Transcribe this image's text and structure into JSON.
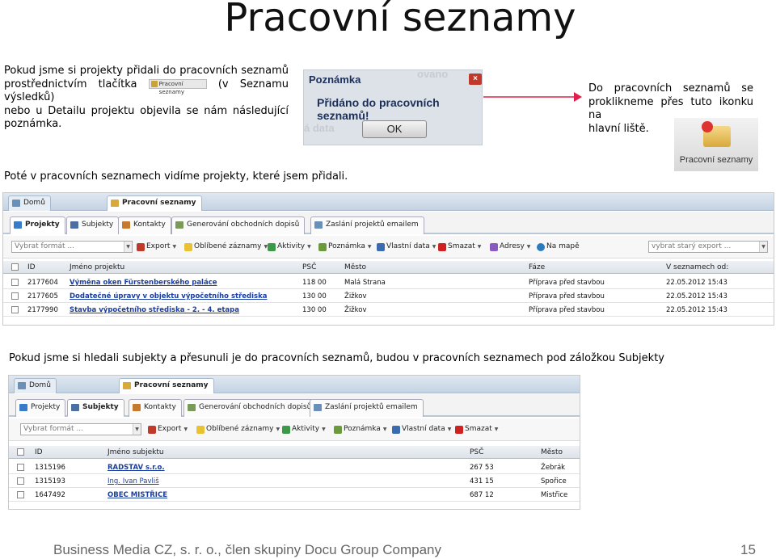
{
  "title": "Pracovní seznamy",
  "para1": {
    "line1": "Pokud jsme si projekty přidali do pracovních seznamů",
    "line2a": "prostřednictvím tlačítka",
    "button_img": "Pracovní seznamy",
    "line2b": "(v Seznamu výsledků)",
    "line3": "nebo u Detailu projektu objevila se nám následující",
    "line4": "poznámka."
  },
  "dialog": {
    "header": "Poznámka",
    "message": "Přidáno do pracovních seznamů!",
    "ok": "OK",
    "ghost1": "ovano",
    "ghost2": "á data",
    "close": "×"
  },
  "para2": {
    "line1": "Do pracovních seznamů se",
    "line2": "proklikneme přes tuto ikonku na",
    "line3": "hlavní liště."
  },
  "icon_label": "Pracovní seznamy",
  "para3": "Poté v pracovních seznamech vidíme projekty, které jsem přidali.",
  "para4": "Pokud jsme si hledali subjekty a přesunuli je do pracovních seznamů, budou v pracovních seznamech pod záložkou Subjekty",
  "shot1": {
    "top_tabs": [
      "Domů",
      "Pracovní seznamy"
    ],
    "sub_tabs": [
      "Projekty",
      "Subjekty",
      "Kontakty",
      "Generování obchodních dopisů",
      "Zaslání projektů emailem"
    ],
    "select_format": "Vybrat formát ...",
    "select_old_export": "vybrat starý export ...",
    "toolbar": [
      "Export",
      "Oblíbené záznamy",
      "Aktivity",
      "Poznámka",
      "Vlastní data",
      "Smazat",
      "Adresy",
      "Na mapě"
    ],
    "columns": [
      "ID",
      "Jméno projektu",
      "PSČ",
      "Město",
      "Fáze",
      "V seznamech od:"
    ],
    "rows": [
      [
        "2177604",
        "Výměna oken Fürstenberského paláce",
        "118 00",
        "Malá Strana",
        "Příprava před stavbou",
        "22.05.2012 15:43"
      ],
      [
        "2177605",
        "Dodatečné úpravy v objektu výpočetního střediska",
        "130 00",
        "Žižkov",
        "Příprava před stavbou",
        "22.05.2012 15:43"
      ],
      [
        "2177990",
        "Stavba výpočetního střediska - 2. - 4. etapa",
        "130 00",
        "Žižkov",
        "Příprava před stavbou",
        "22.05.2012 15:43"
      ]
    ]
  },
  "shot2": {
    "top_tabs": [
      "Domů",
      "Pracovní seznamy"
    ],
    "sub_tabs": [
      "Projekty",
      "Subjekty",
      "Kontakty",
      "Generování obchodních dopisů",
      "Zaslání projektů emailem"
    ],
    "select_format": "Vybrat formát ...",
    "toolbar": [
      "Export",
      "Oblíbené záznamy",
      "Aktivity",
      "Poznámka",
      "Vlastní data",
      "Smazat"
    ],
    "columns": [
      "ID",
      "Jméno subjektu",
      "PSČ",
      "Město"
    ],
    "rows": [
      [
        "1315196",
        "RADSTAV s.r.o.",
        "267 53",
        "Žebrák"
      ],
      [
        "1315193",
        "Ing. Ivan Pavliš",
        "431 15",
        "Spořice"
      ],
      [
        "1647492",
        "OBEC MISTŘICE",
        "687 12",
        "Mistřice"
      ]
    ]
  },
  "footer": "Business Media CZ, s. r. o., člen skupiny Docu Group Company",
  "page_number": "15",
  "colors": {
    "link": "#1a3ea0",
    "arrow": "#e0204a",
    "tab_bar": "#c4d2e2"
  }
}
